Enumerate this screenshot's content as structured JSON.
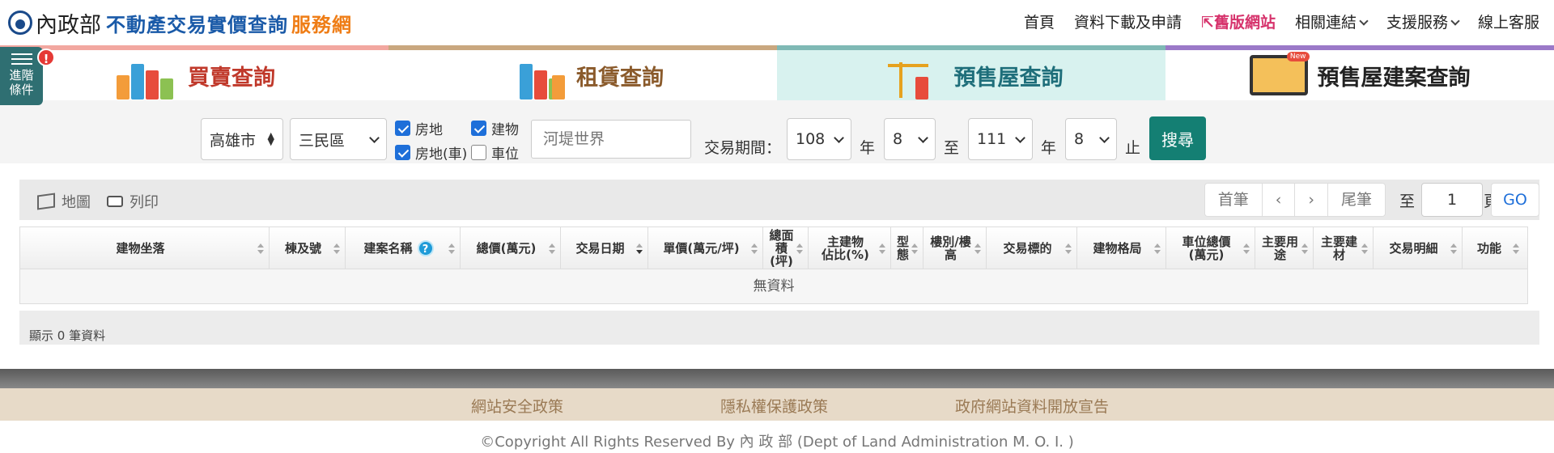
{
  "header": {
    "logo_ministry": "內政部",
    "logo_site_main": "不動產交易實價查詢",
    "logo_site_accent": "服務網",
    "nav": {
      "home": "首頁",
      "download": "資料下載及申請",
      "legacy": "舊版網站",
      "links": "相關連結",
      "support": "支援服務",
      "service": "線上客服"
    }
  },
  "advanced": {
    "label_line1": "進階",
    "label_line2": "條件",
    "alert": "!"
  },
  "tabs": {
    "sale": "買賣查詢",
    "rent": "租賃查詢",
    "presale": "預售屋查詢",
    "project": "預售屋建案查詢",
    "project_badge": "New",
    "active": "presale"
  },
  "search": {
    "city": "高雄市",
    "district": "三民區",
    "cb_land_building": "房地",
    "cb_building": "建物",
    "cb_land_building_parking": "房地(車)",
    "cb_parking": "車位",
    "keyword_placeholder": "河堤世界",
    "period_label": "交易期間",
    "colon": "：",
    "from_year": "108",
    "year_unit_1": "年",
    "from_month": "8",
    "to_label": "至",
    "to_year": "111",
    "year_unit_2": "年",
    "to_month": "8",
    "end_label": "止",
    "search_button": "搜尋"
  },
  "toolbar": {
    "map": "地圖",
    "print": "列印",
    "first": "首筆",
    "prev": "‹",
    "next": "›",
    "last": "尾筆",
    "goto_label": "至",
    "page_value": "1",
    "page_unit": "頁",
    "go": "GO"
  },
  "table": {
    "columns": [
      {
        "label": "建物坐落"
      },
      {
        "label": "棟及號"
      },
      {
        "label": "建案名稱"
      },
      {
        "label": "總價(萬元)"
      },
      {
        "label": "交易日期"
      },
      {
        "label": "單價(萬元/坪)"
      },
      {
        "label": "總面積\n(坪)"
      },
      {
        "label": "主建物\n佔比(%)"
      },
      {
        "label": "型態"
      },
      {
        "label": "樓別/樓高"
      },
      {
        "label": "交易標的"
      },
      {
        "label": "建物格局"
      },
      {
        "label": "車位總價\n(萬元)"
      },
      {
        "label": "主要用途"
      },
      {
        "label": "主要建材"
      },
      {
        "label": "交易明細"
      },
      {
        "label": "功能"
      }
    ],
    "help_glyph": "?",
    "empty": "無資料"
  },
  "info": {
    "count_text": "顯示 0 筆資料"
  },
  "footer": {
    "security": "網站安全政策",
    "privacy": "隱私權保護政策",
    "open_data": "政府網站資料開放宣告",
    "copyright": "©Copyright All Rights Reserved By 內 政 部 (Dept of Land Administration M. O. I. )"
  },
  "colors": {
    "brand_blue": "#1a5aa8",
    "brand_orange": "#ef7d16",
    "search_button": "#147f73",
    "checkbox_on": "#1e6fd9",
    "advanced_bg": "#2f6f72",
    "alert": "#e53935"
  }
}
